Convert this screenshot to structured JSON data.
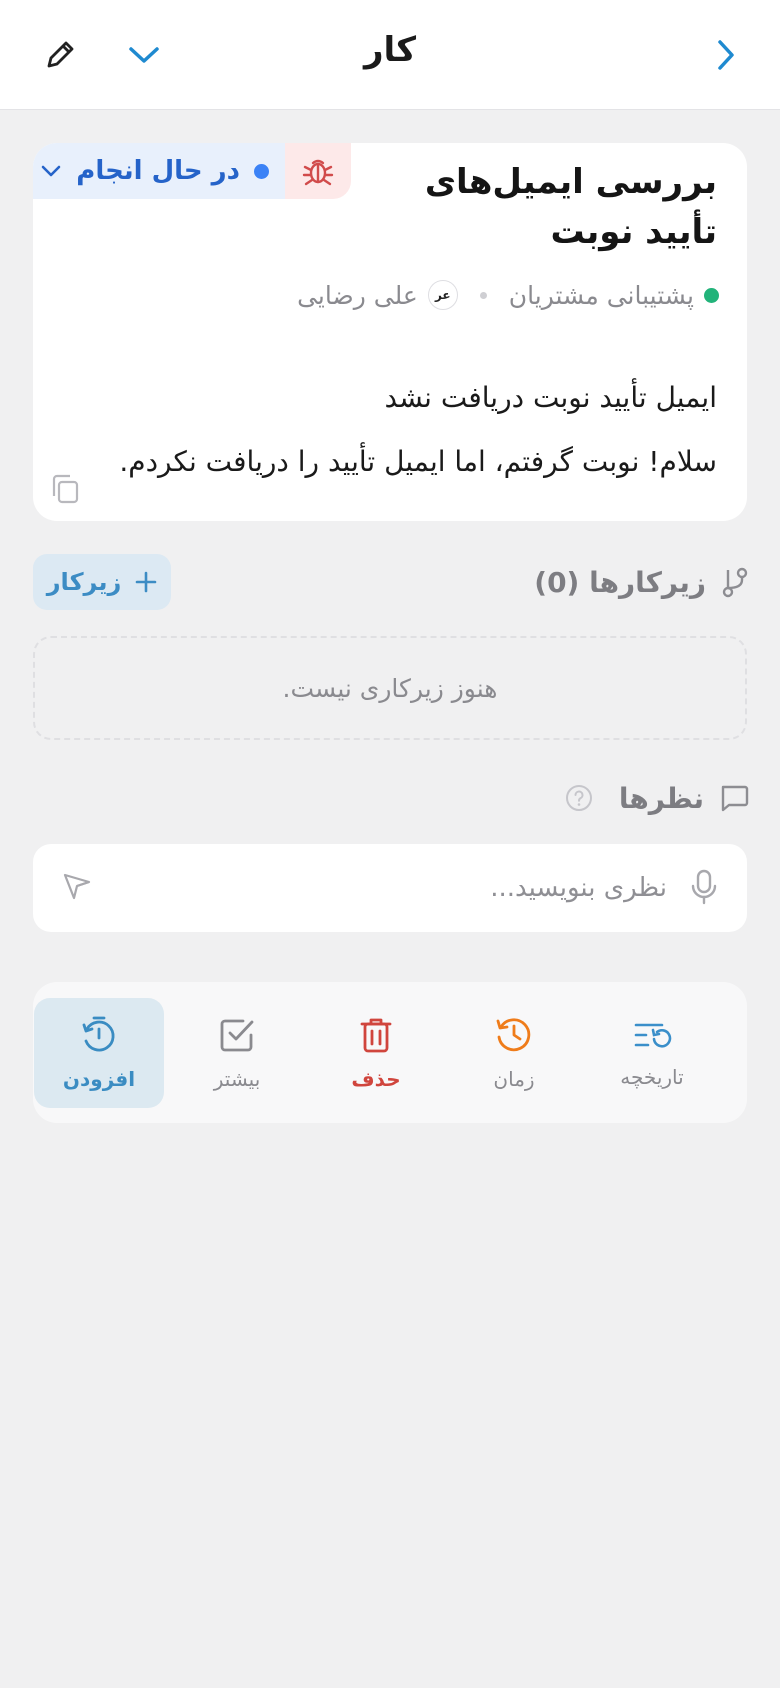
{
  "header": {
    "title": "کار",
    "back_icon": "chevron-right-icon",
    "chevron_icon": "chevron-down-icon",
    "edit_icon": "pencil-icon"
  },
  "task": {
    "title": "بررسی ایمیل‌های تأیید نوبت",
    "type_icon": "bug-icon",
    "status": "در حال انجام",
    "status_color": "#3b82f6",
    "team": "پشتیبانی مشتریان",
    "team_color": "#22b37a",
    "assignee_initials": "عر",
    "assignee": "علی رضایی",
    "description_title": "ایمیل تأیید نوبت دریافت نشد",
    "description_body": "سلام! نوبت گرفتم، اما ایمیل تأیید را دریافت نکردم."
  },
  "subtasks": {
    "title": "زیرکارها (0)",
    "add_label": "زیرکار",
    "empty_text": "هنوز زیرکاری نیست."
  },
  "comments": {
    "title": "نظرها",
    "placeholder": "نظری بنویسید..."
  },
  "actions": [
    {
      "label": "تاریخچه",
      "icon": "history-list-icon",
      "color": "#3b8fca"
    },
    {
      "label": "زمان",
      "icon": "clock-history-icon",
      "color": "#ef7c1a"
    },
    {
      "label": "حذف",
      "icon": "trash-icon",
      "color": "#d0453d"
    },
    {
      "label": "بیشتر",
      "icon": "checkbox-icon",
      "color": "#8a8a8f"
    },
    {
      "label": "افزودن",
      "icon": "timer-add-icon",
      "color": "#3a8cc2"
    }
  ]
}
